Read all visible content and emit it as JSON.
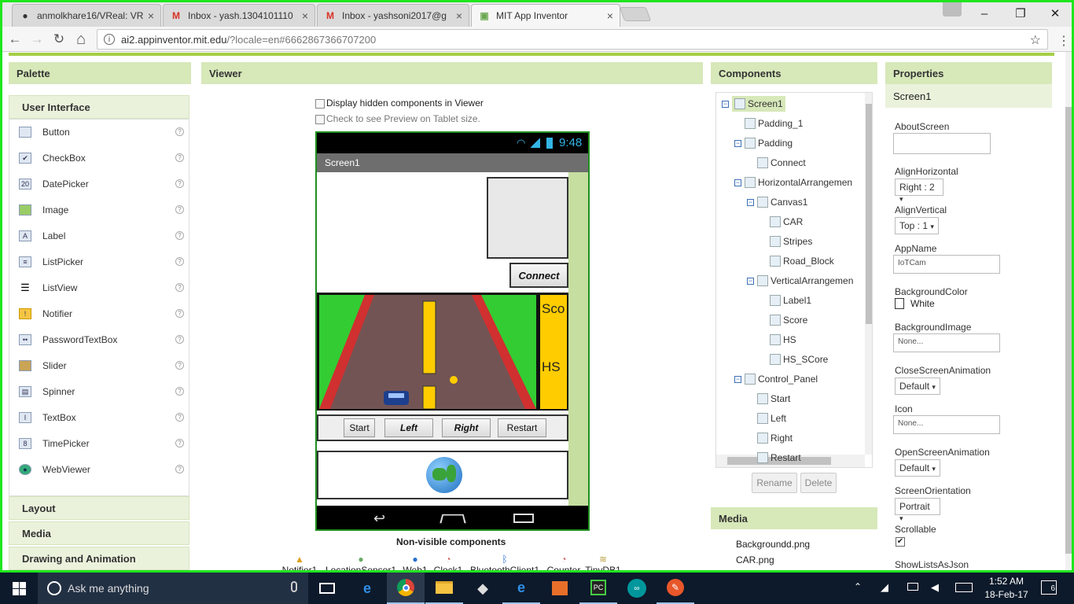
{
  "browser": {
    "tabs": [
      {
        "title": "anmolkhare16/VReal: VR",
        "icon": "github-icon",
        "color": "#222"
      },
      {
        "title": "Inbox - yash.1304101110",
        "icon": "gmail-icon",
        "color": "#d93025"
      },
      {
        "title": "Inbox - yashsoni2017@g",
        "icon": "gmail-icon",
        "color": "#d93025"
      },
      {
        "title": "MIT App Inventor",
        "icon": "appinventor-icon",
        "color": "#6aa84f"
      }
    ],
    "close_glyph": "×",
    "url_host": "ai2.appinventor.mit.edu",
    "url_rest": "/?locale=en#6662867366707200",
    "win_min": "–",
    "win_max": "❐",
    "win_close": "✕",
    "back": "←",
    "forward": "→",
    "reload": "↻",
    "home": "⌂",
    "star": "☆",
    "menu": "⋮",
    "info": "i"
  },
  "palette": {
    "title": "Palette",
    "category": "User Interface",
    "items": [
      {
        "label": "Button",
        "icon": "button-icon",
        "g": ""
      },
      {
        "label": "CheckBox",
        "icon": "checkbox-icon",
        "g": "✔"
      },
      {
        "label": "DatePicker",
        "icon": "datepicker-icon",
        "g": "20"
      },
      {
        "label": "Image",
        "icon": "image-icon",
        "g": ""
      },
      {
        "label": "Label",
        "icon": "label-icon",
        "g": "A"
      },
      {
        "label": "ListPicker",
        "icon": "listpicker-icon",
        "g": "≡"
      },
      {
        "label": "ListView",
        "icon": "listview-icon",
        "g": "☰"
      },
      {
        "label": "Notifier",
        "icon": "notifier-icon",
        "g": "!"
      },
      {
        "label": "PasswordTextBox",
        "icon": "password-icon",
        "g": "••"
      },
      {
        "label": "Slider",
        "icon": "slider-icon",
        "g": ""
      },
      {
        "label": "Spinner",
        "icon": "spinner-icon",
        "g": "▤"
      },
      {
        "label": "TextBox",
        "icon": "textbox-icon",
        "g": "I"
      },
      {
        "label": "TimePicker",
        "icon": "timepicker-icon",
        "g": "8"
      },
      {
        "label": "WebViewer",
        "icon": "webviewer-icon",
        "g": "●"
      }
    ],
    "help": "?",
    "categories": [
      "Layout",
      "Media",
      "Drawing and Animation"
    ]
  },
  "viewer": {
    "title": "Viewer",
    "hidden_label": "Display hidden components in Viewer",
    "tablet_label": "Check to see Preview on Tablet size.",
    "time": "9:48",
    "screen_title": "Screen1",
    "connect": "Connect",
    "score": "Sco",
    "hs": "HS",
    "controls": [
      "Start",
      "Left",
      "Right",
      "Restart"
    ],
    "nonvisible_title": "Non-visible components",
    "nonvisible": [
      "Notifier1",
      "LocationSensor1",
      "Web1",
      "Clock1",
      "BluetoothClient1",
      "Counter",
      "TinyDB1"
    ],
    "colors": {
      "grass": "#33cc33",
      "road": "#735454",
      "edge": "#d03030",
      "lane": "#ffcc00",
      "panel": "#ffcc00",
      "side": "#c6dea0"
    }
  },
  "components": {
    "title": "Components",
    "tree": [
      {
        "label": "Screen1",
        "tog": "⊟"
      },
      {
        "label": "Padding_1",
        "tog": ""
      },
      {
        "label": "Padding",
        "tog": "⊟"
      },
      {
        "label": "Connect",
        "tog": ""
      },
      {
        "label": "HorizontalArrangemen",
        "tog": "⊟"
      },
      {
        "label": "Canvas1",
        "tog": "⊟"
      },
      {
        "label": "CAR",
        "tog": ""
      },
      {
        "label": "Stripes",
        "tog": ""
      },
      {
        "label": "Road_Block",
        "tog": ""
      },
      {
        "label": "VerticalArrangemen",
        "tog": "⊟"
      },
      {
        "label": "Label1",
        "tog": ""
      },
      {
        "label": "Score",
        "tog": ""
      },
      {
        "label": "HS",
        "tog": ""
      },
      {
        "label": "HS_SCore",
        "tog": ""
      },
      {
        "label": "Control_Panel",
        "tog": "⊟"
      },
      {
        "label": "Start",
        "tog": ""
      },
      {
        "label": "Left",
        "tog": ""
      },
      {
        "label": "Right",
        "tog": ""
      },
      {
        "label": "Restart",
        "tog": ""
      }
    ],
    "rename": "Rename",
    "delete": "Delete",
    "media_title": "Media",
    "media": [
      "Backgroundd.png",
      "CAR.png"
    ]
  },
  "properties": {
    "title": "Properties",
    "component": "Screen1",
    "about_label": "AboutScreen",
    "alignh_label": "AlignHorizontal",
    "alignh": "Right : 2",
    "alignv_label": "AlignVertical",
    "alignv": "Top : 1",
    "appname_label": "AppName",
    "appname": "IoTCam",
    "bgcolor_label": "BackgroundColor",
    "bgcolor": "White",
    "bgimage_label": "BackgroundImage",
    "bgimage": "None...",
    "close_label": "CloseScreenAnimation",
    "close": "Default",
    "icon_label": "Icon",
    "icon": "None...",
    "open_label": "OpenScreenAnimation",
    "open": "Default",
    "orient_label": "ScreenOrientation",
    "orient": "Portrait",
    "scroll_label": "Scrollable",
    "showlists_label": "ShowListsAsJson",
    "caret": "▾",
    "check": "✔"
  },
  "taskbar": {
    "search": "Ask me anything",
    "time": "1:52 AM",
    "date": "18-Feb-17",
    "notif": "6"
  }
}
